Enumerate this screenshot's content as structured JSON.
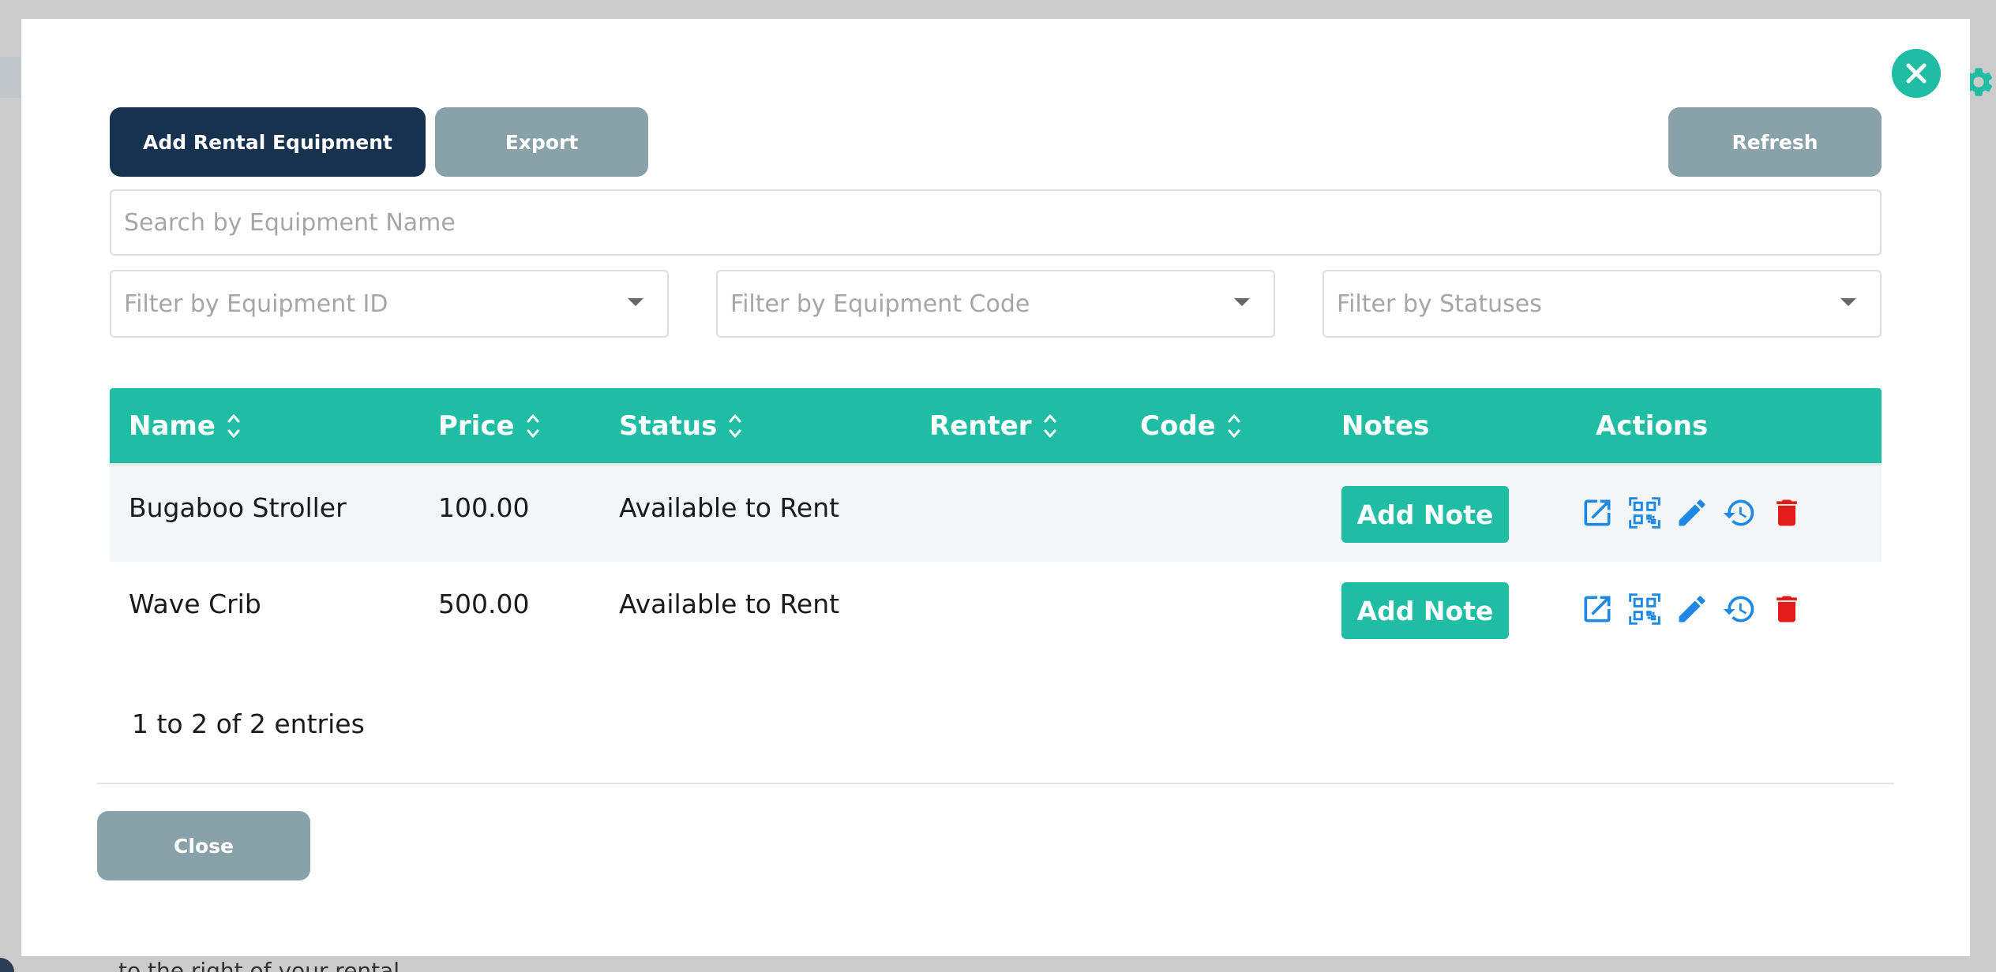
{
  "toolbar": {
    "add_rental_label": "Add Rental Equipment",
    "export_label": "Export",
    "refresh_label": "Refresh"
  },
  "search": {
    "placeholder": "Search by Equipment Name",
    "value": ""
  },
  "filters": [
    {
      "placeholder": "Filter by Equipment ID",
      "icon": "caret-down-icon"
    },
    {
      "placeholder": "Filter by Equipment Code",
      "icon": "caret-down-icon"
    },
    {
      "placeholder": "Filter by Statuses",
      "icon": "caret-down-icon"
    }
  ],
  "table": {
    "columns": [
      {
        "label": "Name",
        "sortable": true
      },
      {
        "label": "Price",
        "sortable": true
      },
      {
        "label": "Status",
        "sortable": true
      },
      {
        "label": "Renter",
        "sortable": true
      },
      {
        "label": "Code",
        "sortable": true
      },
      {
        "label": "Notes",
        "sortable": false
      },
      {
        "label": "Actions",
        "sortable": false
      }
    ],
    "rows": [
      {
        "name": "Bugaboo Stroller",
        "price": "100.00",
        "status": "Available to Rent",
        "renter": "",
        "code": "",
        "note_button": "Add Note"
      },
      {
        "name": "Wave Crib",
        "price": "500.00",
        "status": "Available to Rent",
        "renter": "",
        "code": "",
        "note_button": "Add Note"
      }
    ],
    "row_actions": [
      "open-external-icon",
      "qr-code-icon",
      "edit-pencil-icon",
      "history-icon",
      "delete-trash-icon"
    ]
  },
  "pagination": {
    "summary": "1 to 2 of 2 entries"
  },
  "footer": {
    "close_label": "Close"
  },
  "colors": {
    "header_bg": "#1fbda3",
    "primary_button": "#16324f",
    "secondary_button": "#89a1a8",
    "action_icon": "#1e88e5",
    "delete_icon": "#e21b1b"
  },
  "background": {
    "partial_text": "to the right of your rental"
  }
}
